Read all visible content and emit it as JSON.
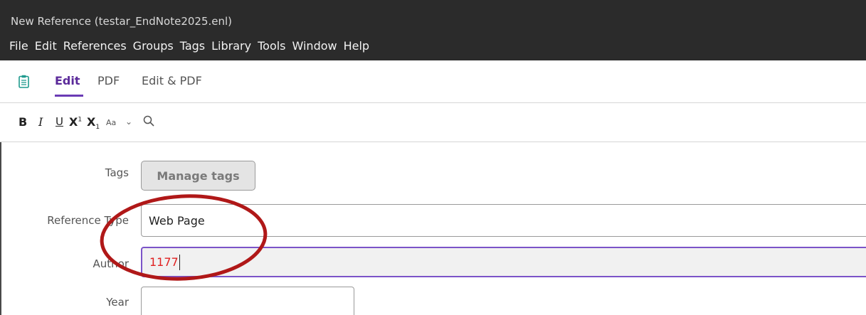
{
  "window": {
    "title": "New Reference (testar_EndNote2025.enl)"
  },
  "menu": [
    "File",
    "Edit",
    "References",
    "Groups",
    "Tags",
    "Library",
    "Tools",
    "Window",
    "Help"
  ],
  "tabs": {
    "edit": "Edit",
    "pdf": "PDF",
    "edit_pdf": "Edit & PDF"
  },
  "format": {
    "bold": "B",
    "italic": "I",
    "underline": "U",
    "superscript_base": "X",
    "superscript_mark": "1",
    "subscript_base": "X",
    "subscript_mark": "1",
    "font_case": "Aa",
    "chevron": "⌄",
    "icons": {
      "search": "search-icon",
      "clipboard": "clipboard-icon"
    }
  },
  "form": {
    "tags_label": "Tags",
    "manage_tags": "Manage tags",
    "reference_type_label": "Reference Type",
    "reference_type_value": "Web Page",
    "author_label": "Author",
    "author_value": "1177",
    "year_label": "Year",
    "year_value": ""
  },
  "colors": {
    "accent": "#6a3bb5",
    "annotation": "#b01818",
    "author_text": "#e02020"
  }
}
